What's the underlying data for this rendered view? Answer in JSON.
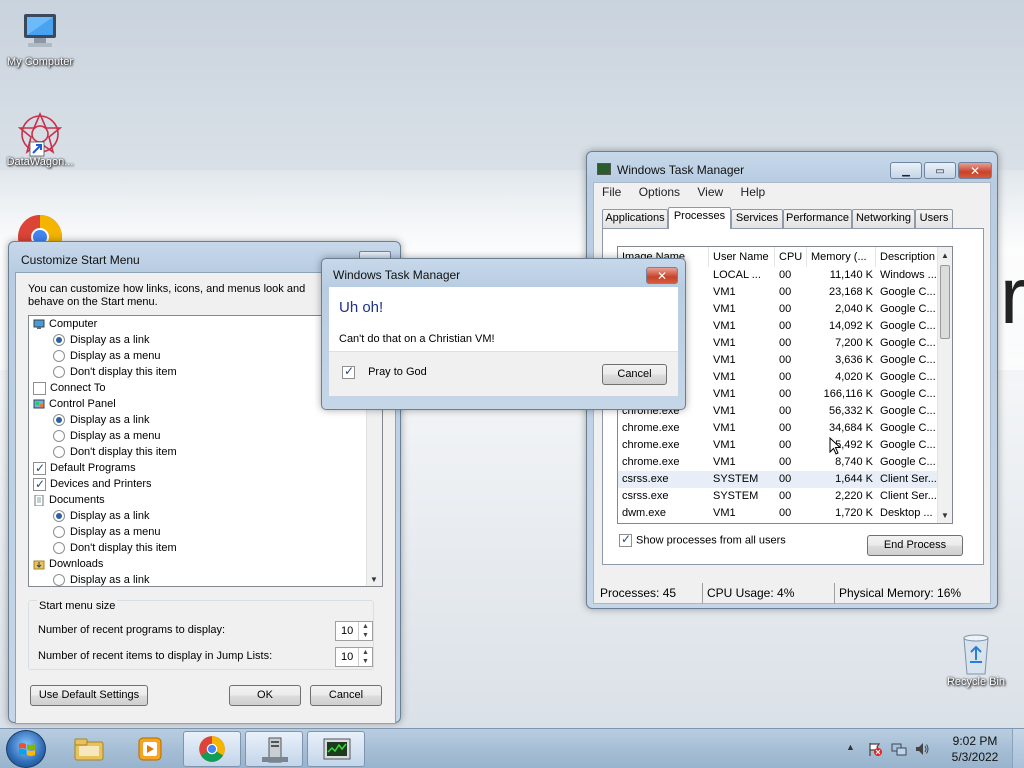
{
  "desktop": {
    "icons": [
      {
        "label": "My Computer"
      },
      {
        "label": "DataWagon..."
      },
      {
        "label": "Recycle Bin"
      }
    ]
  },
  "customize_start_menu": {
    "title": "Customize Start Menu",
    "description": "You can customize how links, icons, and menus look and behave on the Start menu.",
    "items": [
      {
        "label": "Computer",
        "kind": "header",
        "icon": "computer-icon"
      },
      {
        "label": "Display as a link",
        "kind": "radio",
        "checked": true
      },
      {
        "label": "Display as a menu",
        "kind": "radio",
        "checked": false
      },
      {
        "label": "Don't display this item",
        "kind": "radio",
        "checked": false
      },
      {
        "label": "Connect To",
        "kind": "check",
        "checked": false
      },
      {
        "label": "Control Panel",
        "kind": "header",
        "icon": "control-panel-icon"
      },
      {
        "label": "Display as a link",
        "kind": "radio",
        "checked": true
      },
      {
        "label": "Display as a menu",
        "kind": "radio",
        "checked": false
      },
      {
        "label": "Don't display this item",
        "kind": "radio",
        "checked": false
      },
      {
        "label": "Default Programs",
        "kind": "check",
        "checked": true
      },
      {
        "label": "Devices and Printers",
        "kind": "check",
        "checked": true
      },
      {
        "label": "Documents",
        "kind": "header",
        "icon": "documents-icon"
      },
      {
        "label": "Display as a link",
        "kind": "radio",
        "checked": true
      },
      {
        "label": "Display as a menu",
        "kind": "radio",
        "checked": false
      },
      {
        "label": "Don't display this item",
        "kind": "radio",
        "checked": false
      },
      {
        "label": "Downloads",
        "kind": "header",
        "icon": "downloads-icon"
      },
      {
        "label": "Display as a link",
        "kind": "radio",
        "checked": false
      }
    ],
    "size_group_label": "Start menu size",
    "recent_programs_label": "Number of recent programs to display:",
    "recent_programs_value": "10",
    "recent_items_label": "Number of recent items to display in Jump Lists:",
    "recent_items_value": "10",
    "default_button": "Use Default Settings",
    "ok_button": "OK",
    "cancel_button": "Cancel"
  },
  "task_manager": {
    "title": "Windows Task Manager",
    "menu": [
      "File",
      "Options",
      "View",
      "Help"
    ],
    "tabs": [
      "Applications",
      "Processes",
      "Services",
      "Performance",
      "Networking",
      "Users"
    ],
    "active_tab": "Processes",
    "columns": [
      "Image Name",
      "User Name",
      "CPU",
      "Memory (...",
      "Description"
    ],
    "rows": [
      [
        "",
        "LOCAL ...",
        "00",
        "11,140 K",
        "Windows ..."
      ],
      [
        "",
        "VM1",
        "00",
        "23,168 K",
        "Google C..."
      ],
      [
        "",
        "VM1",
        "00",
        "2,040 K",
        "Google C..."
      ],
      [
        "",
        "VM1",
        "00",
        "14,092 K",
        "Google C..."
      ],
      [
        "",
        "VM1",
        "00",
        "7,200 K",
        "Google C..."
      ],
      [
        "",
        "VM1",
        "00",
        "3,636 K",
        "Google C..."
      ],
      [
        "",
        "VM1",
        "00",
        "4,020 K",
        "Google C..."
      ],
      [
        "",
        "VM1",
        "00",
        "166,116 K",
        "Google C..."
      ],
      [
        "chrome.exe",
        "VM1",
        "00",
        "56,332 K",
        "Google C..."
      ],
      [
        "chrome.exe",
        "VM1",
        "00",
        "34,684 K",
        "Google C..."
      ],
      [
        "chrome.exe",
        "VM1",
        "00",
        "5,492 K",
        "Google C..."
      ],
      [
        "chrome.exe",
        "VM1",
        "00",
        "8,740 K",
        "Google C..."
      ],
      [
        "csrss.exe",
        "SYSTEM",
        "00",
        "1,644 K",
        "Client Ser..."
      ],
      [
        "csrss.exe",
        "SYSTEM",
        "00",
        "2,220 K",
        "Client Ser..."
      ],
      [
        "dwm.exe",
        "VM1",
        "00",
        "1,720 K",
        "Desktop ..."
      ]
    ],
    "show_all_label": "Show processes from all users",
    "show_all_checked": true,
    "end_process": "End Process",
    "status_processes": "Processes: 45",
    "status_cpu": "CPU Usage: 4%",
    "status_memory": "Physical Memory: 16%"
  },
  "error_dialog": {
    "title": "Windows Task Manager",
    "heading": "Uh oh!",
    "message": "Can't do that on a Christian VM!",
    "checkbox_label": "Pray to God",
    "checkbox_checked": true,
    "cancel_button": "Cancel"
  },
  "taskbar": {
    "time": "9:02 PM",
    "date": "5/3/2022"
  },
  "colors": {
    "accent": "#2c5fa8",
    "close": "#c7432b",
    "heading": "#1e3287"
  }
}
